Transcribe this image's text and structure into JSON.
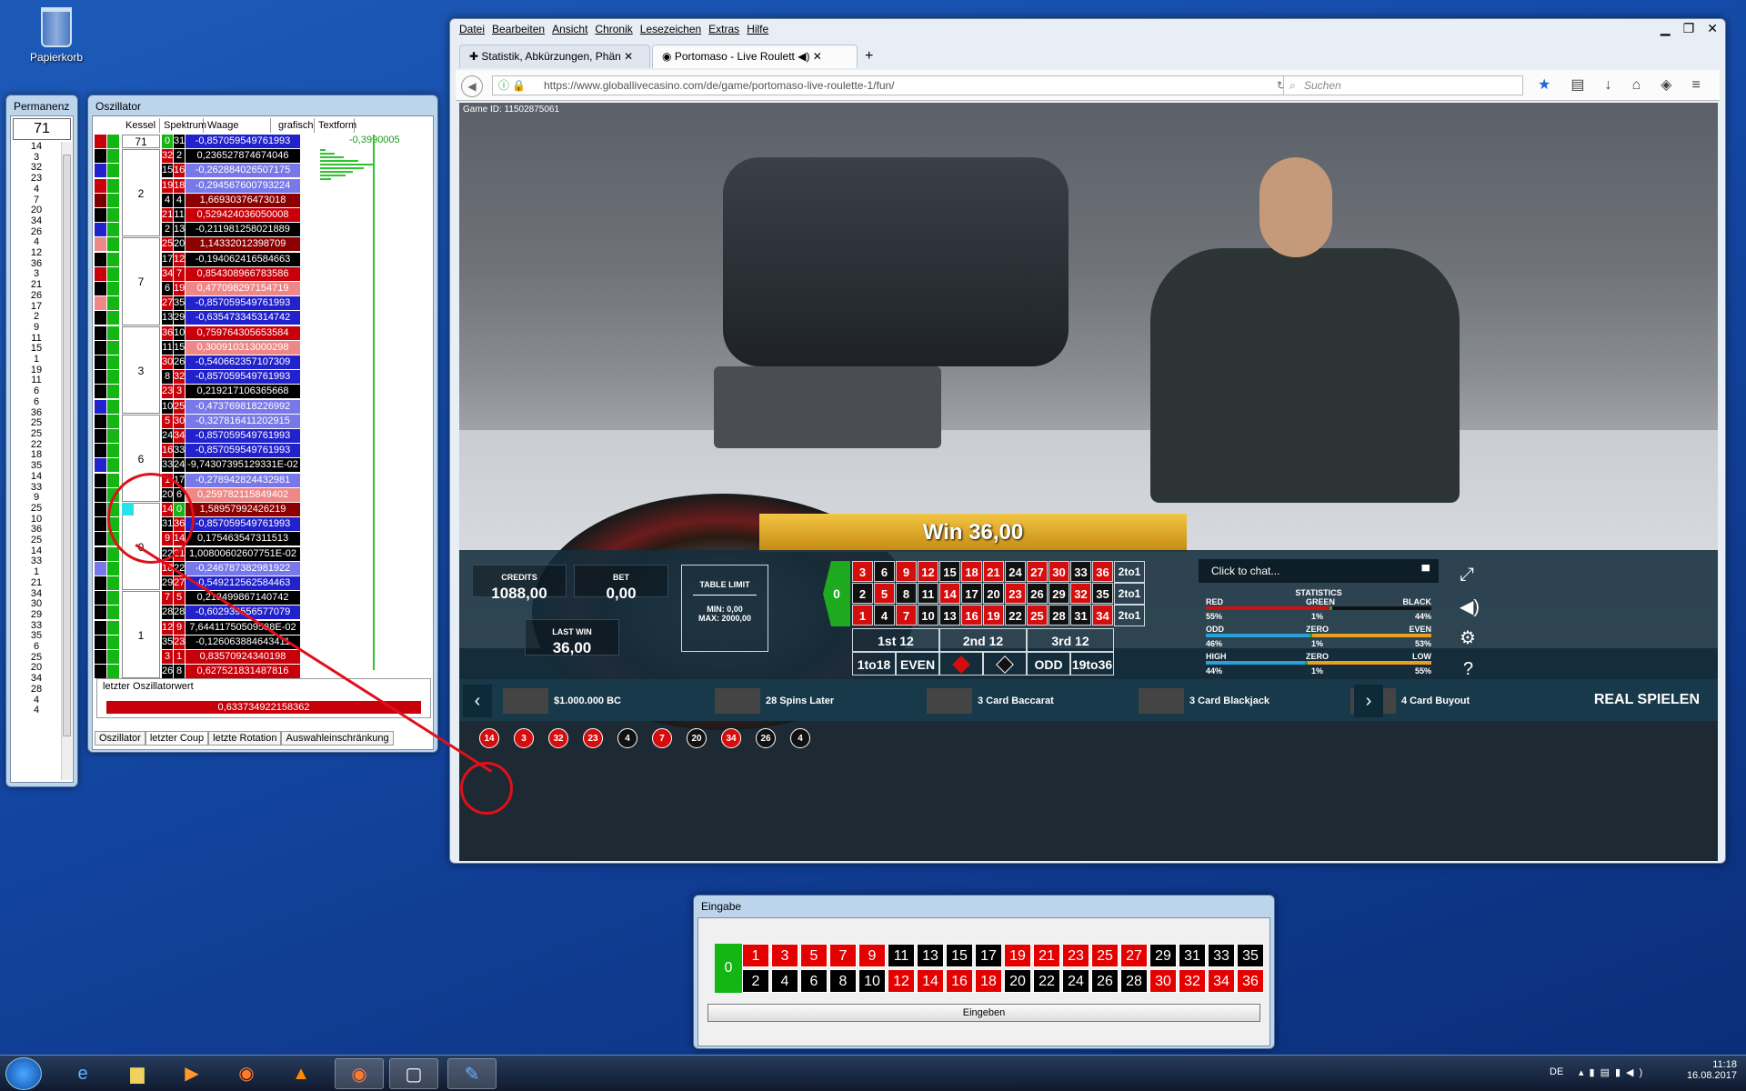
{
  "desktop": {
    "recycle_bin": "Papierkorb"
  },
  "permanenz": {
    "title": "Permanenz",
    "top": "71",
    "list": [
      "14",
      "3",
      "32",
      "23",
      "4",
      "7",
      "20",
      "34",
      "26",
      "4",
      "12",
      "36",
      "3",
      "21",
      "26",
      "17",
      "2",
      "9",
      "11",
      "15",
      "1",
      "19",
      "11",
      "6",
      "6",
      "36",
      "25",
      "25",
      "22",
      "18",
      "35",
      "14",
      "33",
      "9",
      "25",
      "10",
      "36",
      "25",
      "14",
      "33",
      "1",
      "21",
      "34",
      "30",
      "29",
      "33",
      "35",
      "6",
      "25",
      "20",
      "34",
      "28",
      "4",
      "4"
    ]
  },
  "osz": {
    "title": "Oszillator",
    "headers": [
      "Kessel",
      "Spektrum",
      "Waage",
      "grafisch",
      "Textform"
    ],
    "graph_value": "-0,3990005",
    "rows": [
      {
        "a": "#c8000a",
        "b": "#13b613",
        "n1": "0",
        "n1c": "#13b613",
        "n2": "31",
        "n2c": "#000",
        "v": "-0,857059549761993",
        "vc": "#2222cc"
      },
      {
        "a": "#000",
        "b": "#13b613",
        "n1": "32",
        "n1c": "#c8000a",
        "n2": "2",
        "n2c": "#000",
        "v": "0,236527874674046",
        "vc": "#000"
      },
      {
        "a": "#2222cc",
        "b": "#13b613",
        "n1": "15",
        "n1c": "#000",
        "n2": "16",
        "n2c": "#c8000a",
        "v": "-0,262884026507175",
        "vc": "#7878e8"
      },
      {
        "a": "#c8000a",
        "b": "#13b613",
        "n1": "19",
        "n1c": "#c8000a",
        "n2": "18",
        "n2c": "#c8000a",
        "v": "-0,294567600793224",
        "vc": "#7878e8"
      },
      {
        "a": "#7a0000",
        "b": "#13b613",
        "n1": "4",
        "n1c": "#000",
        "n2": "4",
        "n2c": "#000",
        "v": "1,66930376473018",
        "vc": "#8b0000"
      },
      {
        "a": "#000",
        "b": "#13b613",
        "n1": "21",
        "n1c": "#c8000a",
        "n2": "11",
        "n2c": "#000",
        "v": "0,529424036050008",
        "vc": "#c8000a"
      },
      {
        "a": "#2222cc",
        "b": "#13b613",
        "n1": "2",
        "n1c": "#000",
        "n2": "13",
        "n2c": "#000",
        "v": "-0,211981258021889",
        "vc": "#000"
      },
      {
        "a": "#ee8888",
        "b": "#13b613",
        "n1": "25",
        "n1c": "#c8000a",
        "n2": "20",
        "n2c": "#000",
        "v": "1,14332012398709",
        "vc": "#8b0000"
      },
      {
        "a": "#000",
        "b": "#13b613",
        "n1": "17",
        "n1c": "#000",
        "n2": "12",
        "n2c": "#c8000a",
        "v": "-0,194062416584663",
        "vc": "#000"
      },
      {
        "a": "#c8000a",
        "b": "#13b613",
        "n1": "34",
        "n1c": "#c8000a",
        "n2": "7",
        "n2c": "#c8000a",
        "v": "0,854308966783586",
        "vc": "#c8000a"
      },
      {
        "a": "#000",
        "b": "#13b613",
        "n1": "6",
        "n1c": "#000",
        "n2": "19",
        "n2c": "#c8000a",
        "v": "0,477098297154719",
        "vc": "#ee8888"
      },
      {
        "a": "#ee8888",
        "b": "#13b613",
        "n1": "27",
        "n1c": "#c8000a",
        "n2": "35",
        "n2c": "#000",
        "v": "-0,857059549761993",
        "vc": "#2222cc"
      },
      {
        "a": "#000",
        "b": "#13b613",
        "n1": "13",
        "n1c": "#000",
        "n2": "29",
        "n2c": "#000",
        "v": "-0,635473345314742",
        "vc": "#2222cc"
      },
      {
        "a": "#000",
        "b": "#13b613",
        "n1": "36",
        "n1c": "#c8000a",
        "n2": "10",
        "n2c": "#000",
        "v": "0,759764305653584",
        "vc": "#c8000a"
      },
      {
        "a": "#000",
        "b": "#13b613",
        "n1": "11",
        "n1c": "#000",
        "n2": "15",
        "n2c": "#000",
        "v": "0,300910313000298",
        "vc": "#ee8888"
      },
      {
        "a": "#000",
        "b": "#13b613",
        "n1": "30",
        "n1c": "#c8000a",
        "n2": "26",
        "n2c": "#000",
        "v": "-0,540662357107309",
        "vc": "#2222cc"
      },
      {
        "a": "#000",
        "b": "#13b613",
        "n1": "8",
        "n1c": "#000",
        "n2": "32",
        "n2c": "#c8000a",
        "v": "-0,857059549761993",
        "vc": "#2222cc"
      },
      {
        "a": "#000",
        "b": "#13b613",
        "n1": "23",
        "n1c": "#c8000a",
        "n2": "3",
        "n2c": "#c8000a",
        "v": "0,219217106365668",
        "vc": "#000"
      },
      {
        "a": "#2222cc",
        "b": "#13b613",
        "n1": "10",
        "n1c": "#000",
        "n2": "25",
        "n2c": "#c8000a",
        "v": "-0,473769818226992",
        "vc": "#7878e8"
      },
      {
        "a": "#000",
        "b": "#13b613",
        "n1": "5",
        "n1c": "#c8000a",
        "n2": "30",
        "n2c": "#c8000a",
        "v": "-0,327816411202915",
        "vc": "#7878e8"
      },
      {
        "a": "#000",
        "b": "#13b613",
        "n1": "24",
        "n1c": "#000",
        "n2": "34",
        "n2c": "#c8000a",
        "v": "-0,857059549761993",
        "vc": "#2222cc"
      },
      {
        "a": "#000",
        "b": "#13b613",
        "n1": "16",
        "n1c": "#c8000a",
        "n2": "33",
        "n2c": "#000",
        "v": "-0,857059549761993",
        "vc": "#2222cc"
      },
      {
        "a": "#2222cc",
        "b": "#13b613",
        "n1": "33",
        "n1c": "#000",
        "n2": "24",
        "n2c": "#000",
        "v": "-9,74307395129331E-02",
        "vc": "#000"
      },
      {
        "a": "#000",
        "b": "#13b613",
        "n1": "1",
        "n1c": "#c8000a",
        "n2": "17",
        "n2c": "#000",
        "v": "-0,278942824432981",
        "vc": "#7878e8"
      },
      {
        "a": "#000",
        "b": "#13b613",
        "n1": "20",
        "n1c": "#000",
        "n2": "6",
        "n2c": "#000",
        "v": "0,259782115849402",
        "vc": "#ee8888"
      },
      {
        "a": "#000",
        "b": "#13b613",
        "n1": "14",
        "n1c": "#c8000a",
        "n2": "0",
        "n2c": "#13b613",
        "v": "1,58957992426219",
        "vc": "#8b0000"
      },
      {
        "a": "#000",
        "b": "#13b613",
        "n1": "31",
        "n1c": "#000",
        "n2": "36",
        "n2c": "#c8000a",
        "v": "-0,857059549761993",
        "vc": "#2222cc"
      },
      {
        "a": "#000",
        "b": "#13b613",
        "n1": "9",
        "n1c": "#c8000a",
        "n2": "14",
        "n2c": "#c8000a",
        "v": "0,175463547311513",
        "vc": "#000"
      },
      {
        "a": "#000",
        "b": "#13b613",
        "n1": "22",
        "n1c": "#000",
        "n2": "21",
        "n2c": "#c8000a",
        "v": "1,00800602607751E-02",
        "vc": "#000"
      },
      {
        "a": "#7878e8",
        "b": "#13b613",
        "n1": "18",
        "n1c": "#c8000a",
        "n2": "22",
        "n2c": "#000",
        "v": "-0,246787382981922",
        "vc": "#7878e8"
      },
      {
        "a": "#000",
        "b": "#13b613",
        "n1": "29",
        "n1c": "#000",
        "n2": "27",
        "n2c": "#c8000a",
        "v": "-0,549212562584463",
        "vc": "#2222cc"
      },
      {
        "a": "#000",
        "b": "#13b613",
        "n1": "7",
        "n1c": "#c8000a",
        "n2": "5",
        "n2c": "#c8000a",
        "v": "0,213499867140742",
        "vc": "#000"
      },
      {
        "a": "#000",
        "b": "#13b613",
        "n1": "28",
        "n1c": "#000",
        "n2": "28",
        "n2c": "#000",
        "v": "-0,602939556577079",
        "vc": "#2222cc"
      },
      {
        "a": "#000",
        "b": "#13b613",
        "n1": "12",
        "n1c": "#c8000a",
        "n2": "9",
        "n2c": "#c8000a",
        "v": "7,64411750509588E-02",
        "vc": "#000"
      },
      {
        "a": "#000",
        "b": "#13b613",
        "n1": "35",
        "n1c": "#000",
        "n2": "23",
        "n2c": "#c8000a",
        "v": "-0,126063884643411",
        "vc": "#000"
      },
      {
        "a": "#000",
        "b": "#13b613",
        "n1": "3",
        "n1c": "#c8000a",
        "n2": "1",
        "n2c": "#c8000a",
        "v": "0,83570924340198",
        "vc": "#c8000a"
      },
      {
        "a": "#000",
        "b": "#13b613",
        "n1": "26",
        "n1c": "#000",
        "n2": "8",
        "n2c": "#000",
        "v": "0,627521831487816",
        "vc": "#c8000a"
      }
    ],
    "kessel": [
      {
        "label": "71",
        "row": 0,
        "span": 1
      },
      {
        "label": "2",
        "row": 1,
        "span": 6
      },
      {
        "label": "7",
        "row": 7,
        "span": 6
      },
      {
        "label": "3",
        "row": 13,
        "span": 6
      },
      {
        "label": "6",
        "row": 19,
        "span": 6
      },
      {
        "label": "0",
        "row": 25,
        "span": 6
      },
      {
        "label": "1",
        "row": 31,
        "span": 6
      }
    ],
    "foot_label": "letzter Oszillatorwert",
    "foot_value": "0,633734922158362",
    "tabs": [
      "Oszillator",
      "letzter Coup",
      "letzte Rotation",
      "Auswahleinschränkung"
    ]
  },
  "ff": {
    "menu": [
      "Datei",
      "Bearbeiten",
      "Ansicht",
      "Chronik",
      "Lesezeichen",
      "Extras",
      "Hilfe"
    ],
    "tab1": "Statistik, Abkürzungen, Phän",
    "tab2": "Portomaso - Live Roulett",
    "url": "https://www.globallivecasino.com/de/game/portomaso-live-roulette-1/fun/",
    "search": "Suchen"
  },
  "game": {
    "id": "Game ID: 11502875061",
    "win": "Win 36,00",
    "credits_label": "CREDITS",
    "credits": "1088,00",
    "bet_label": "BET",
    "bet": "0,00",
    "lastwin_label": "LAST WIN",
    "lastwin": "36,00",
    "table_limit": "TABLE LIMIT",
    "min": "MIN: 0,00",
    "max": "MAX: 2000,00",
    "chat": "Click to chat...",
    "stats_title": "STATISTICS",
    "stats": [
      {
        "l": "RED",
        "m": "GREEN",
        "r": "BLACK",
        "lp": "55%",
        "mp": "1%",
        "rp": "44%",
        "lv": 55,
        "mv": 1,
        "lc": "#d50d0d",
        "mc": "#1eaa1e",
        "rc": "#111"
      },
      {
        "l": "ODD",
        "m": "ZERO",
        "r": "EVEN",
        "lp": "46%",
        "mp": "1%",
        "rp": "53%",
        "lv": 46,
        "mv": 1,
        "lc": "#2aa0d8",
        "mc": "#1eaa1e",
        "rc": "#e8a020"
      },
      {
        "l": "HIGH",
        "m": "ZERO",
        "r": "LOW",
        "lp": "44%",
        "mp": "1%",
        "rp": "55%",
        "lv": 44,
        "mv": 1,
        "lc": "#2aa0d8",
        "mc": "#1eaa1e",
        "rc": "#e8a020"
      }
    ],
    "history": [
      {
        "n": "14",
        "c": "#d50d0d"
      },
      {
        "n": "3",
        "c": "#d50d0d"
      },
      {
        "n": "32",
        "c": "#d50d0d"
      },
      {
        "n": "23",
        "c": "#d50d0d"
      },
      {
        "n": "4",
        "c": "#111"
      },
      {
        "n": "7",
        "c": "#d50d0d"
      },
      {
        "n": "20",
        "c": "#111"
      },
      {
        "n": "34",
        "c": "#d50d0d"
      },
      {
        "n": "26",
        "c": "#111"
      },
      {
        "n": "4",
        "c": "#111"
      }
    ],
    "dozens": [
      "1st 12",
      "2nd 12",
      "3rd 12"
    ],
    "outside": [
      "1to18",
      "EVEN",
      "",
      "",
      "ODD",
      "19to36"
    ],
    "twotoone": "2to1",
    "bottom": [
      {
        "label": "$1.000.000 BC"
      },
      {
        "label": "28 Spins Later"
      },
      {
        "label": "3 Card Baccarat"
      },
      {
        "label": "3 Card Blackjack"
      },
      {
        "label": "4 Card Buyout"
      }
    ],
    "real": "REAL SPIELEN"
  },
  "eingabe": {
    "title": "Eingabe",
    "button": "Eingeben"
  },
  "taskbar": {
    "lang": "DE",
    "time": "11:18",
    "date": "16.08.2017"
  }
}
